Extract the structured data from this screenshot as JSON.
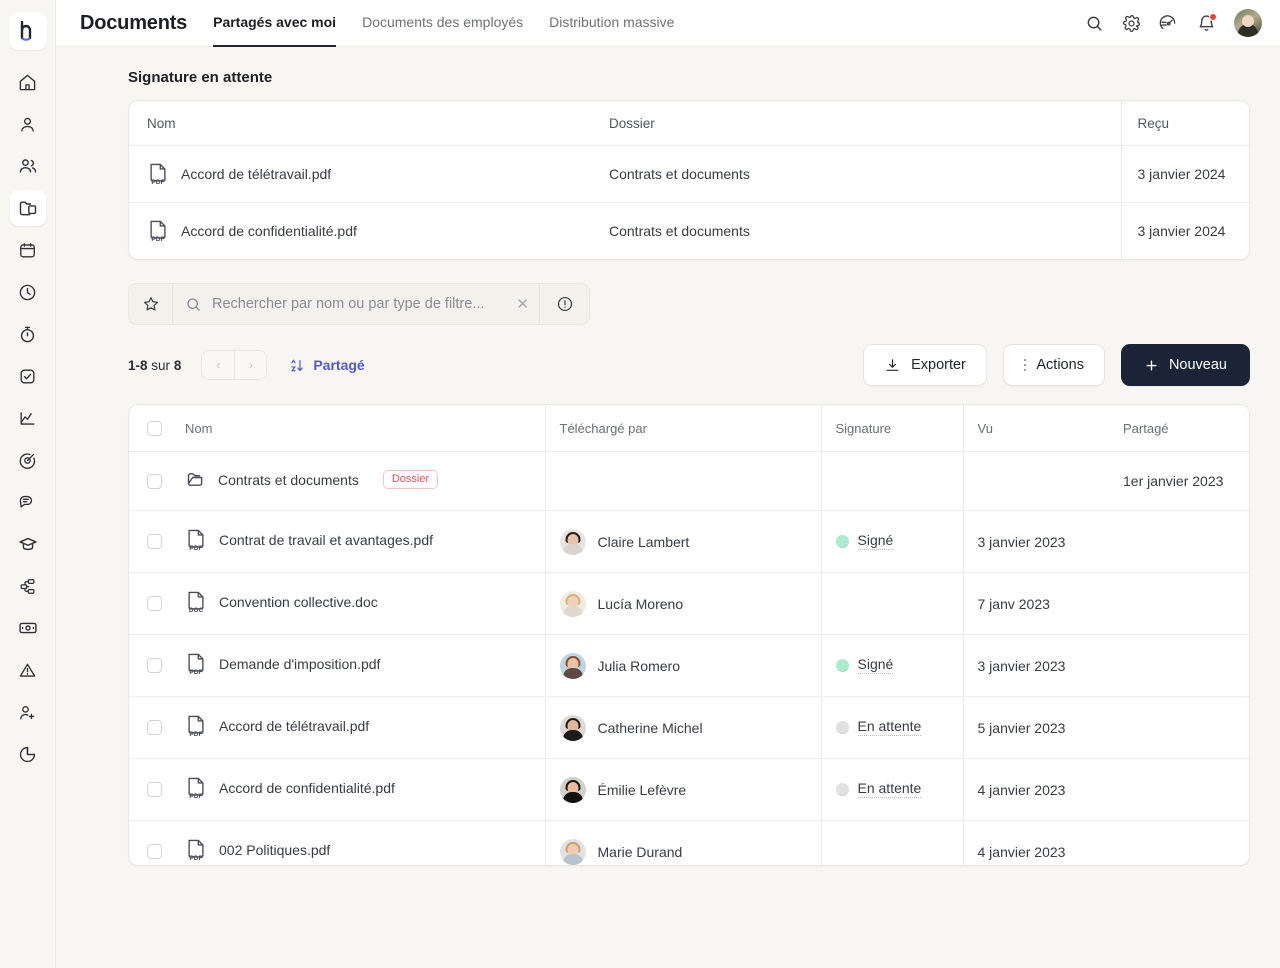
{
  "app": {
    "logo_letter": "h",
    "title": "Documents"
  },
  "tabs": [
    {
      "label": "Partagés avec moi",
      "active": true
    },
    {
      "label": "Documents des employés",
      "active": false
    },
    {
      "label": "Distribution massive",
      "active": false
    }
  ],
  "topbar_icons": [
    {
      "name": "search-icon"
    },
    {
      "name": "gear-icon"
    },
    {
      "name": "speedometer-icon"
    },
    {
      "name": "bell-icon",
      "badge": true
    },
    {
      "name": "user-avatar"
    }
  ],
  "sidebar": {
    "items": [
      {
        "name": "home-icon",
        "active": false
      },
      {
        "name": "person-icon",
        "active": false
      },
      {
        "name": "people-icon",
        "active": false
      },
      {
        "name": "folder-documents-icon",
        "active": true
      },
      {
        "name": "calendar-icon",
        "active": false
      },
      {
        "name": "clock-icon",
        "active": false
      },
      {
        "name": "stopwatch-icon",
        "active": false
      },
      {
        "name": "checkbox-task-icon",
        "active": false
      },
      {
        "name": "chart-line-icon",
        "active": false
      },
      {
        "name": "target-icon",
        "active": false
      },
      {
        "name": "chat-bubble-icon",
        "active": false
      },
      {
        "name": "graduation-cap-icon",
        "active": false
      },
      {
        "name": "workflow-icon",
        "active": false
      },
      {
        "name": "money-icon",
        "active": false
      },
      {
        "name": "alert-triangle-icon",
        "active": false
      },
      {
        "name": "user-add-icon",
        "active": false
      },
      {
        "name": "pie-chart-icon",
        "active": false
      }
    ]
  },
  "pending_section": {
    "title": "Signature en attente",
    "columns": [
      "Nom",
      "Dossier",
      "Reçu"
    ],
    "rows": [
      {
        "icon": "pdf-file-icon",
        "name": "Accord de télétravail.pdf",
        "folder": "Contrats et documents",
        "received": "3 janvier 2024"
      },
      {
        "icon": "pdf-file-icon",
        "name": "Accord de confidentialité.pdf",
        "folder": "Contrats et documents",
        "received": "3 janvier 2024"
      }
    ]
  },
  "filterbar": {
    "star_icon": "star-icon",
    "search_placeholder": "Rechercher par nom ou par type de filtre...",
    "search_value": "",
    "clear_label": "✕",
    "info_icon": "info-circle-icon"
  },
  "toolbar": {
    "range": "1-8",
    "of_word": "sur",
    "total": "8",
    "prev_label": "‹",
    "next_label": "›",
    "sort_label": "Partagé",
    "export_label": "Exporter",
    "actions_label": "Actions",
    "new_label": "Nouveau",
    "new_plus": "+"
  },
  "documents_table": {
    "columns": [
      "",
      "Nom",
      "Téléchargé par",
      "Signature",
      "Vu",
      "Partagé"
    ],
    "rows": [
      {
        "icon": "folder-icon",
        "name": "Contrats et documents",
        "badge": "Dossier",
        "uploader": "",
        "avatar_skin": "",
        "avatar_hair": "",
        "avatar_bg": "",
        "signature": "",
        "signature_state": "none",
        "seen": "",
        "shared": "1er janvier 2023"
      },
      {
        "icon": "pdf-file-icon",
        "name": "Contrat de travail et avantages.pdf",
        "badge": "",
        "uploader": "Claire Lambert",
        "avatar_skin": "#e8c3aa",
        "avatar_hair": "#241d1b",
        "avatar_bg": "#e9e6e1",
        "signature": "Signé",
        "signature_state": "signed",
        "seen": "3 janvier 2023",
        "shared": ""
      },
      {
        "icon": "doc-file-icon",
        "name": "Convention collective.doc",
        "badge": "",
        "uploader": "Lucía Moreno",
        "avatar_skin": "#f0d3b6",
        "avatar_hair": "#d8b278",
        "avatar_bg": "#efeae2",
        "signature": "",
        "signature_state": "none",
        "seen": "7 janv 2023",
        "shared": ""
      },
      {
        "icon": "pdf-file-icon",
        "name": "Demande d'imposition.pdf",
        "badge": "",
        "uploader": "Julia Romero",
        "avatar_skin": "#edc3a6",
        "avatar_hair": "#8a4a33",
        "avatar_bg": "#bcd7e4",
        "signature": "Signé",
        "signature_state": "signed",
        "seen": "3 janvier 2023",
        "shared": ""
      },
      {
        "icon": "pdf-file-icon",
        "name": "Accord de télétravail.pdf",
        "badge": "",
        "uploader": "Catherine Michel",
        "avatar_skin": "#e3b795",
        "avatar_hair": "#221a17",
        "avatar_bg": "#ddd9d4",
        "signature": "En attente",
        "signature_state": "pending",
        "seen": "5 janvier 2023",
        "shared": ""
      },
      {
        "icon": "pdf-file-icon",
        "name": "Accord de confidentialité.pdf",
        "badge": "",
        "uploader": "Émilie Lefèvre",
        "avatar_skin": "#e9bb9a",
        "avatar_hair": "#17120f",
        "avatar_bg": "#cfd2cb",
        "signature": "En attente",
        "signature_state": "pending",
        "seen": "4 janvier 2023",
        "shared": ""
      },
      {
        "icon": "pdf-file-icon",
        "name": "002 Politiques.pdf",
        "badge": "",
        "uploader": "Marie Durand",
        "avatar_skin": "#f0cbb0",
        "avatar_hair": "#c9a06a",
        "avatar_bg": "#dfe3e6",
        "signature": "",
        "signature_state": "none",
        "seen": "4 janvier 2023",
        "shared": ""
      }
    ]
  },
  "colors": {
    "accent_blue": "#4f5ad4",
    "dark_button": "#1b2437",
    "badge_red": "#d9515c",
    "signed_green": "#a9ecce",
    "pending_gray": "#e2e1df",
    "page_bg": "#f7f6f3",
    "notification_red": "#ef4136"
  }
}
